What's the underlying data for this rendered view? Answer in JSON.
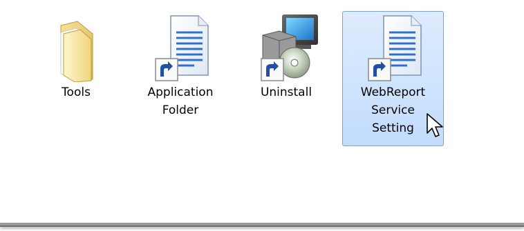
{
  "items": [
    {
      "label": "Tools",
      "icon": "folder-icon",
      "selected": false
    },
    {
      "label": "Application\nFolder",
      "icon": "document-shortcut-icon",
      "selected": false
    },
    {
      "label": "Uninstall",
      "icon": "uninstall-shortcut-icon",
      "selected": false
    },
    {
      "label": "WebReport\nService\nSetting",
      "icon": "document-shortcut-icon",
      "selected": true
    }
  ],
  "colors": {
    "selection_bg": "#cce4fe",
    "selection_border": "#7da2ce"
  }
}
